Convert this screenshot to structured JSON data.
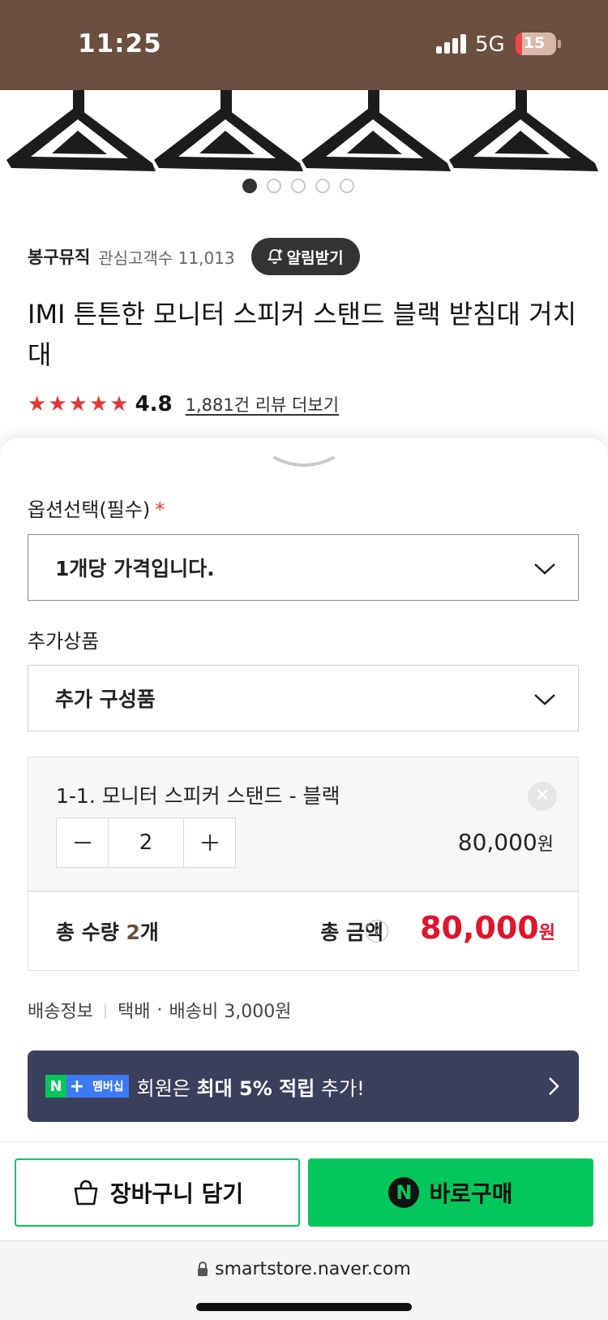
{
  "status_bar": {
    "time": "11:25",
    "network": "5G",
    "battery": "15",
    "battery_level": 0.15,
    "bg_color": "#6b4f3f"
  },
  "gallery": {
    "image_icon": "monitor-stand-triangle-base",
    "dot_count": 5,
    "active_index": 0
  },
  "store": {
    "name": "봉구뮤직",
    "followers": "관심고객수 11,013",
    "notify_label": "알림받기",
    "notify_icon": "bell-plus-icon"
  },
  "product": {
    "title": "IMI 튼튼한 모니터 스피커 스탠드 블랙 받침대 거치대",
    "rating": "4.8",
    "stars": 5,
    "star_color": "#e53737",
    "reviews": "1,881건 리뷰 더보기"
  },
  "options": {
    "label": "옵션선택(필수)",
    "required_mark": "*",
    "selected": "1개당 가격입니다.",
    "extra_label": "추가상품",
    "extra_placeholder": "추가 구성품"
  },
  "selected_item": {
    "name": "1-1. 모니터 스피커 스탠드 - 블랙",
    "quantity": "2",
    "price": "80,000",
    "price_unit": "원"
  },
  "totals": {
    "qty_label": "총 수량",
    "qty_value": "2",
    "qty_unit": "개",
    "amount_label": "총 금액",
    "amount": "80,000",
    "amount_unit": "원",
    "accent_color": "#e0142b"
  },
  "shipping": {
    "label": "배송정보",
    "method": "택배",
    "fee": "배송비 3,000원"
  },
  "membership": {
    "badge_n": "N",
    "badge_plus": "+",
    "badge_text": "멤버십",
    "text_prefix": "회원은 ",
    "text_bold": "최대 5% 적립",
    "text_suffix": " 추가!"
  },
  "actions": {
    "cart_label": "장바구니 담기",
    "buy_label": "바로구매",
    "buy_icon_letter": "N",
    "brand_color": "#03c75a"
  },
  "browser": {
    "url": "smartstore.naver.com"
  }
}
